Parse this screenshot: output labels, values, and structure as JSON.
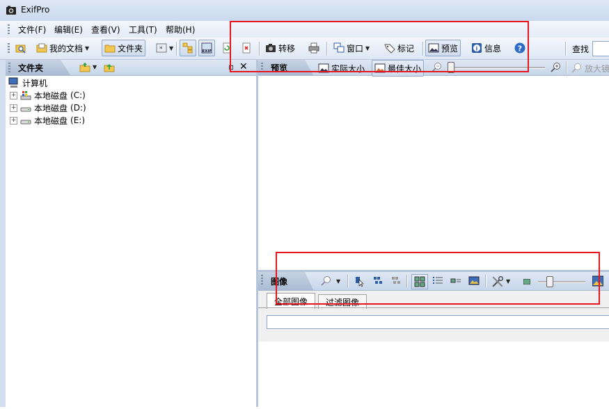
{
  "window": {
    "title": "ExifPro"
  },
  "menu": [
    "文件(F)",
    "编辑(E)",
    "查看(V)",
    "工具(T)",
    "帮助(H)"
  ],
  "toolbar": {
    "my_docs": "我的文档",
    "folder": "文件夹",
    "transfer": "转移",
    "window": "窗口",
    "tag": "标记",
    "preview": "预览",
    "info": "信息",
    "search_label": "查找"
  },
  "left_panel": {
    "title": "文件夹",
    "tree": {
      "root": "计算机",
      "drives": [
        {
          "label": "本地磁盘",
          "letter": "(C:)"
        },
        {
          "label": "本地磁盘",
          "letter": "(D:)"
        },
        {
          "label": "本地磁盘",
          "letter": "(E:)"
        }
      ]
    }
  },
  "preview_panel": {
    "title": "预览",
    "actual_size": "实际大小",
    "best_size": "最佳大小",
    "zoom_in": "放大镜"
  },
  "images_panel": {
    "title": "图像",
    "tabs": [
      "全部图像",
      "过滤图像"
    ]
  },
  "colors": {
    "highlight_box": "#e8141b",
    "chrome": "#dde7f4"
  },
  "icons": [
    "camera-app-icon",
    "folder-browse-icon",
    "zoom-out-icon",
    "zoom-in-icon",
    "info-icon",
    "help-icon"
  ]
}
